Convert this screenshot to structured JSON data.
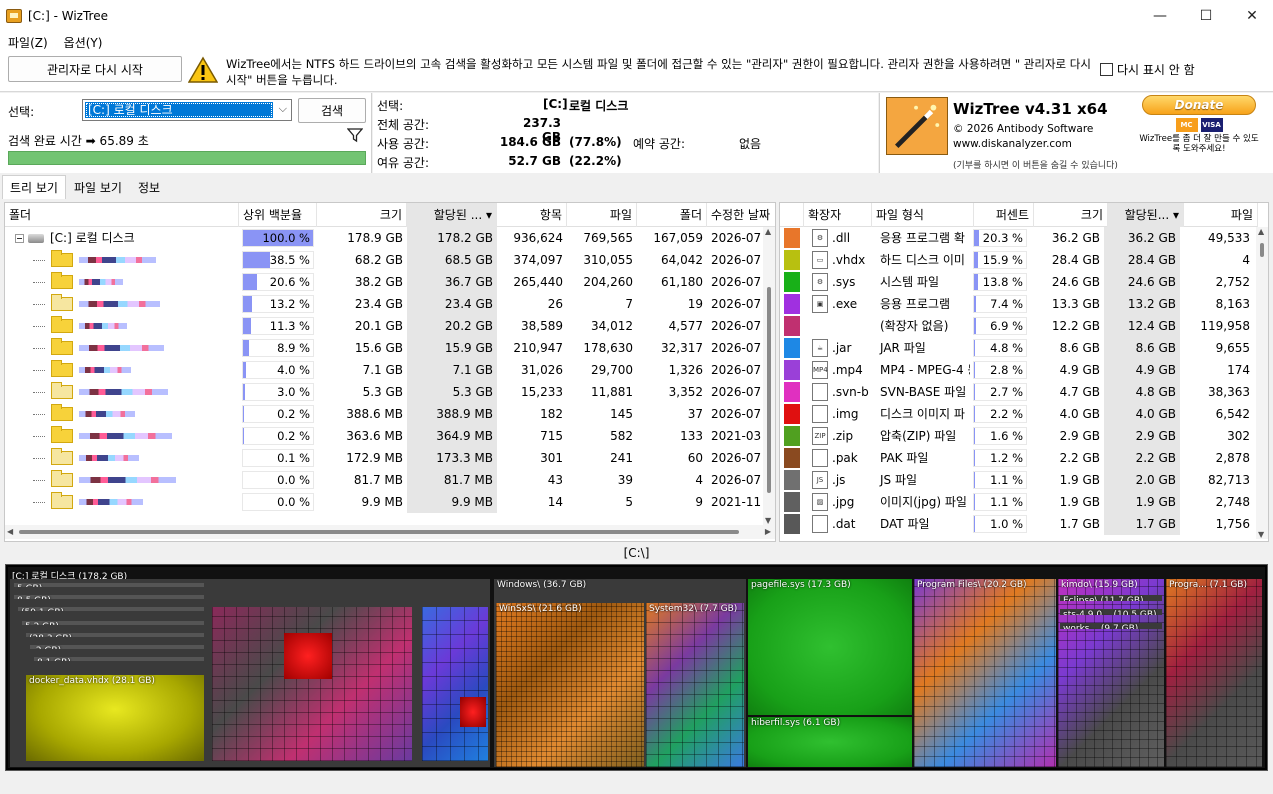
{
  "window": {
    "title": "[C:] - WizTree",
    "min": "—",
    "max": "☐",
    "close": "✕"
  },
  "menu": [
    {
      "label": "파일(Z)"
    },
    {
      "label": "옵션(Y)"
    }
  ],
  "admin": {
    "restart_label": "관리자로 다시 시작",
    "warning_text": "WizTree에서는 NTFS 하드 드라이브의 고속 검색을 활성화하고 모든 시스템 파일 및 폴더에 접근할 수 있는 \"관리자\" 권한이 필요합니다. 관리자 권한을 사용하려면 \" 관리자로 다시 시작\" 버튼을 누릅니다.",
    "noshow_label": "다시 표시 안 함"
  },
  "select": {
    "label": "선택:",
    "drive": "[C:] 로컬 디스크",
    "search_label": "검색",
    "scan_time": "검색 완료 시간 ➡ 65.89 초"
  },
  "info": {
    "selected_label": "선택:",
    "selected_drive": "[C:]",
    "selected_name": "로컬 디스크",
    "total_label": "전체 공간:",
    "total": "237.3 GB",
    "used_label": "사용 공간:",
    "used": "184.6 GB",
    "used_pct": "(77.8%)",
    "reserved_label": "예약 공간:",
    "reserved": "없음",
    "free_label": "여유 공간:",
    "free": "52.7 GB",
    "free_pct": "(22.2%)"
  },
  "brand": {
    "name": "WizTree v4.31 x64",
    "copyright": "© 2026 Antibody Software",
    "url": "www.diskanalyzer.com",
    "note": "(기부를 하시면 이 버튼을 숨길 수 있습니다)",
    "donate": "Donate",
    "donate_note": "WizTree를 좀 더 잘 만들 수 있도록 도와주세요!"
  },
  "tabs": [
    {
      "label": "트리 보기"
    },
    {
      "label": "파일 보기"
    },
    {
      "label": "정보"
    }
  ],
  "tree": {
    "headers": [
      "폴더",
      "상위 백분율",
      "크기",
      "할당된 ...",
      "항목",
      "파일",
      "폴더",
      "수정한 날짜"
    ],
    "rows": [
      {
        "name": "[C:] 로컬 디스크",
        "pct": 100.0,
        "pct_label": "100.0 %",
        "size": "178.9 GB",
        "alloc": "178.2 GB",
        "items": "936,624",
        "files": "769,565",
        "folders": "167,059",
        "date": "2026-07"
      },
      {
        "name": "",
        "pct": 38.5,
        "pct_label": "38.5 %",
        "size": "68.2 GB",
        "alloc": "68.5 GB",
        "items": "374,097",
        "files": "310,055",
        "folders": "64,042",
        "date": "2026-07"
      },
      {
        "name": "",
        "pct": 20.6,
        "pct_label": "20.6 %",
        "size": "38.2 GB",
        "alloc": "36.7 GB",
        "items": "265,440",
        "files": "204,260",
        "folders": "61,180",
        "date": "2026-07"
      },
      {
        "name": "",
        "pct": 13.2,
        "pct_label": "13.2 %",
        "size": "23.4 GB",
        "alloc": "23.4 GB",
        "items": "26",
        "files": "7",
        "folders": "19",
        "date": "2026-07"
      },
      {
        "name": "",
        "pct": 11.3,
        "pct_label": "11.3 %",
        "size": "20.1 GB",
        "alloc": "20.2 GB",
        "items": "38,589",
        "files": "34,012",
        "folders": "4,577",
        "date": "2026-07"
      },
      {
        "name": "",
        "pct": 8.9,
        "pct_label": "8.9 %",
        "size": "15.6 GB",
        "alloc": "15.9 GB",
        "items": "210,947",
        "files": "178,630",
        "folders": "32,317",
        "date": "2026-07"
      },
      {
        "name": "",
        "pct": 4.0,
        "pct_label": "4.0 %",
        "size": "7.1 GB",
        "alloc": "7.1 GB",
        "items": "31,026",
        "files": "29,700",
        "folders": "1,326",
        "date": "2026-07"
      },
      {
        "name": "",
        "pct": 3.0,
        "pct_label": "3.0 %",
        "size": "5.3 GB",
        "alloc": "5.3 GB",
        "items": "15,233",
        "files": "11,881",
        "folders": "3,352",
        "date": "2026-07"
      },
      {
        "name": "",
        "pct": 0.2,
        "pct_label": "0.2 %",
        "size": "388.6 MB",
        "alloc": "388.9 MB",
        "items": "182",
        "files": "145",
        "folders": "37",
        "date": "2026-07"
      },
      {
        "name": "",
        "pct": 0.2,
        "pct_label": "0.2 %",
        "size": "363.6 MB",
        "alloc": "364.9 MB",
        "items": "715",
        "files": "582",
        "folders": "133",
        "date": "2021-03"
      },
      {
        "name": "",
        "pct": 0.1,
        "pct_label": "0.1 %",
        "size": "172.9 MB",
        "alloc": "173.3 MB",
        "items": "301",
        "files": "241",
        "folders": "60",
        "date": "2026-07"
      },
      {
        "name": "",
        "pct": 0.0,
        "pct_label": "0.0 %",
        "size": "81.7 MB",
        "alloc": "81.7 MB",
        "items": "43",
        "files": "39",
        "folders": "4",
        "date": "2026-07"
      },
      {
        "name": "",
        "pct": 0.0,
        "pct_label": "0.0 %",
        "size": "9.9 MB",
        "alloc": "9.9 MB",
        "items": "14",
        "files": "5",
        "folders": "9",
        "date": "2021-11"
      }
    ]
  },
  "ext": {
    "headers": [
      "확장자",
      "파일 형식",
      "퍼센트",
      "크기",
      "할당된...",
      "파일"
    ],
    "rows": [
      {
        "color": "#e8762a",
        "icon": "dll-icon",
        "ext": ".dll",
        "type": "응용 프로그램 확",
        "pct": 20.3,
        "pct_label": "20.3 %",
        "size": "36.2 GB",
        "alloc": "36.2 GB",
        "files": "49,533"
      },
      {
        "color": "#b8c010",
        "icon": "vhdx-icon",
        "ext": ".vhdx",
        "type": "하드 디스크 이미",
        "pct": 15.9,
        "pct_label": "15.9 %",
        "size": "28.4 GB",
        "alloc": "28.4 GB",
        "files": "4"
      },
      {
        "color": "#18b018",
        "icon": "sys-icon",
        "ext": ".sys",
        "type": "시스템 파일",
        "pct": 13.8,
        "pct_label": "13.8 %",
        "size": "24.6 GB",
        "alloc": "24.6 GB",
        "files": "2,752"
      },
      {
        "color": "#a030e0",
        "icon": "exe-icon",
        "ext": ".exe",
        "type": "응용 프로그램",
        "pct": 7.4,
        "pct_label": "7.4 %",
        "size": "13.3 GB",
        "alloc": "13.2 GB",
        "files": "8,163"
      },
      {
        "color": "#c03070",
        "icon": "none-icon",
        "ext": "",
        "type": "(확장자 없음)",
        "pct": 6.9,
        "pct_label": "6.9 %",
        "size": "12.2 GB",
        "alloc": "12.4 GB",
        "files": "119,958"
      },
      {
        "color": "#1e88e5",
        "icon": "jar-icon",
        "ext": ".jar",
        "type": "JAR 파일",
        "pct": 4.8,
        "pct_label": "4.8 %",
        "size": "8.6 GB",
        "alloc": "8.6 GB",
        "files": "9,655"
      },
      {
        "color": "#9a40d8",
        "icon": "mp4-icon",
        "ext": ".mp4",
        "type": "MP4 - MPEG-4 동",
        "pct": 2.8,
        "pct_label": "2.8 %",
        "size": "4.9 GB",
        "alloc": "4.9 GB",
        "files": "174"
      },
      {
        "color": "#e030c0",
        "icon": "svn-icon",
        "ext": ".svn-b",
        "type": "SVN-BASE 파일",
        "pct": 2.7,
        "pct_label": "2.7 %",
        "size": "4.7 GB",
        "alloc": "4.8 GB",
        "files": "38,363"
      },
      {
        "color": "#e01010",
        "icon": "img-icon",
        "ext": ".img",
        "type": "디스크 이미지 파",
        "pct": 2.2,
        "pct_label": "2.2 %",
        "size": "4.0 GB",
        "alloc": "4.0 GB",
        "files": "6,542"
      },
      {
        "color": "#50a020",
        "icon": "zip-icon",
        "ext": ".zip",
        "type": "압축(ZIP) 파일",
        "pct": 1.6,
        "pct_label": "1.6 %",
        "size": "2.9 GB",
        "alloc": "2.9 GB",
        "files": "302"
      },
      {
        "color": "#8a4a20",
        "icon": "pak-icon",
        "ext": ".pak",
        "type": "PAK 파일",
        "pct": 1.2,
        "pct_label": "1.2 %",
        "size": "2.2 GB",
        "alloc": "2.2 GB",
        "files": "2,878"
      },
      {
        "color": "#707070",
        "icon": "js-icon",
        "ext": ".js",
        "type": "JS 파일",
        "pct": 1.1,
        "pct_label": "1.1 %",
        "size": "1.9 GB",
        "alloc": "2.0 GB",
        "files": "82,713"
      },
      {
        "color": "#606060",
        "icon": "jpg-icon",
        "ext": ".jpg",
        "type": "이미지(jpg) 파일",
        "pct": 1.1,
        "pct_label": "1.1 %",
        "size": "1.9 GB",
        "alloc": "1.9 GB",
        "files": "2,748"
      },
      {
        "color": "#585858",
        "icon": "dat-icon",
        "ext": ".dat",
        "type": "DAT 파일",
        "pct": 1.0,
        "pct_label": "1.0 %",
        "size": "1.7 GB",
        "alloc": "1.7 GB",
        "files": "1,756"
      }
    ]
  },
  "path": "[C:\\]",
  "treemap": {
    "root": "[C:] 로컬 디스크 (178.2 GB)",
    "labels": {
      "l1": "5 GB)",
      "l2": "8.5 GB)",
      "l3": "(59.1 GB)",
      "l4": "5.2 GB)",
      "l5": "(28.3 GB)",
      "l6": ".2 GB)",
      "l7": "8.1 GB)",
      "docker": "docker_data.vhdx (28.1 GB)",
      "windows": "Windows\\ (36.7 GB)",
      "winsxs": "WinSxS\\ (21.6 GB)",
      "system32": "System32\\ (7.7 GB)",
      "pagefile": "pagefile.sys (17.3 GB)",
      "hiberfil": "hiberfil.sys (6.1 GB)",
      "programfiles": "Program Files\\ (20.2 GB)",
      "kimdo": "kimdo\\ (15.9 GB)",
      "eclipse": "Eclipse\\ (11.7 GB)",
      "sts": "sts-4.9.0... (10.5 GB)",
      "works": "works... (9.7 GB)",
      "progra": "Progra... (7.1 GB)"
    }
  }
}
